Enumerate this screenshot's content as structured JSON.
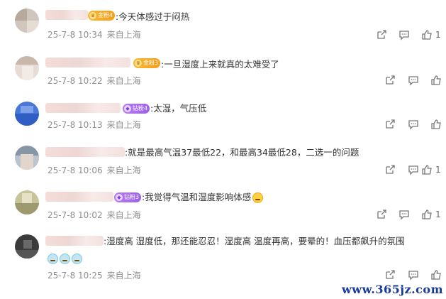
{
  "comments": [
    {
      "text": ":今天体感过于闷热",
      "date": "25-7-8 10:34",
      "location": "来自上海",
      "badge": "金粉4",
      "badge_type": "gold",
      "likes": "1"
    },
    {
      "text": ":一旦湿度上来就真的太难受了",
      "date": "25-7-8 10:22",
      "location": "来自上海",
      "badge": "金粉3",
      "badge_type": "gold",
      "likes": ""
    },
    {
      "text": ":太湿，气压低",
      "date": "25-7-8 10:13",
      "location": "来自上海",
      "badge": "钻粉4",
      "badge_type": "purple",
      "likes": ""
    },
    {
      "text": ":就是最高气温37最低22，和最高34最低28，二选一的问题",
      "date": "25-7-8 10:06",
      "location": "来自上海",
      "badge": "",
      "badge_type": "",
      "likes": "1"
    },
    {
      "text": ":我觉得气温和湿度影响体感",
      "date": "25-7-8 10:02",
      "location": "来自上海",
      "badge": "钻粉3",
      "badge_type": "purple",
      "likes": "1"
    },
    {
      "text": ":湿度高 湿度低，那还能忍忍！湿度高 温度再高，要晕的！血压都飙升的氛围",
      "date": "25-7-8 10:25",
      "location": "来自上海",
      "badge": "",
      "badge_type": "",
      "likes": ""
    }
  ],
  "watermark": "www.365jz.com",
  "icons": {
    "forward": "forward-icon",
    "comment": "comment-icon",
    "like": "like-icon"
  }
}
